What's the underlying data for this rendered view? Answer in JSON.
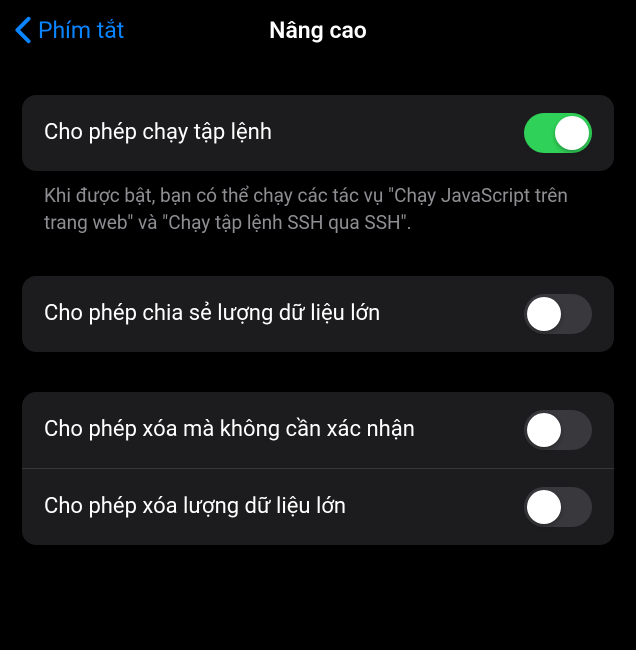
{
  "nav": {
    "back_label": "Phím tắt",
    "title": "Nâng cao"
  },
  "sections": [
    {
      "rows": [
        {
          "label": "Cho phép chạy tập lệnh",
          "toggle": true
        }
      ],
      "footer": "Khi được bật, bạn có thể chạy các tác vụ \"Chạy JavaScript trên trang web\" và \"Chạy tập lệnh SSH qua SSH\"."
    },
    {
      "rows": [
        {
          "label": "Cho phép chia sẻ lượng dữ liệu lớn",
          "toggle": false
        }
      ]
    },
    {
      "rows": [
        {
          "label": "Cho phép xóa mà không cần xác nhận",
          "toggle": false
        },
        {
          "label": "Cho phép xóa lượng dữ liệu lớn",
          "toggle": false
        }
      ]
    }
  ],
  "colors": {
    "toggle_on": "#30d158",
    "toggle_off": "#39393d",
    "accent": "#0a84ff"
  }
}
